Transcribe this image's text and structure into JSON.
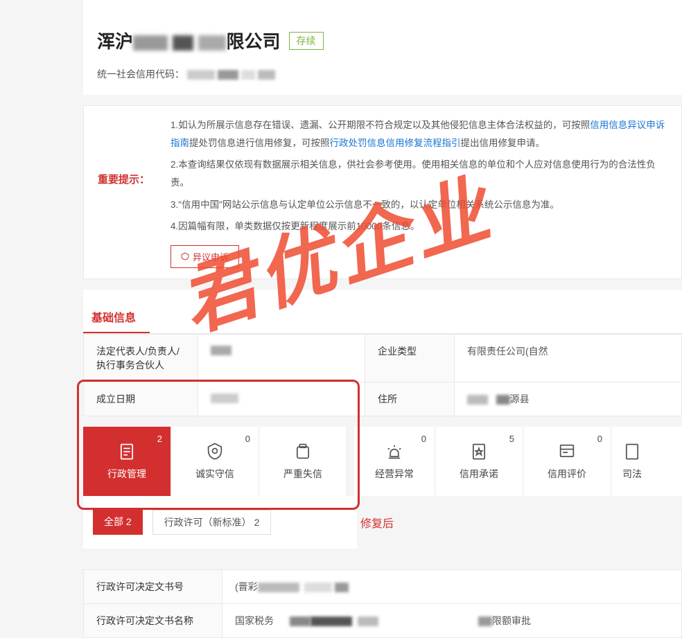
{
  "header": {
    "company_prefix": "浑沪",
    "company_suffix": "限公司",
    "status": "存续",
    "credit_code_label": "统一社会信用代码："
  },
  "notice": {
    "label": "重要提示：",
    "line1a": "1.如认为所展示信息存在错误、遗漏、公开期限不符合规定以及其他侵犯信息主体合法权益的，可按照",
    "link1": "信用信息异议申诉指南",
    "line1b": "提处罚信息进行信用修复，可按照",
    "link2": "行政处罚信息信用修复流程指引",
    "line1c": "提出信用修复申请。",
    "line2": "2.本查询结果仅依现有数据展示相关信息，供社会参考使用。使用相关信息的单位和个人应对信息使用行为的合法性负责。",
    "line3": "3.\"信用中国\"网站公示信息与认定单位公示信息不一致的，以认定单位相关系统公示信息为准。",
    "line4": "4.因篇幅有限，单类数据仅按更新程度展示前10000条信息。",
    "appeal_btn": "异议申诉"
  },
  "basic_info": {
    "title": "基础信息",
    "rows": [
      {
        "label1": "法定代表人/负责人/执行事务合伙人",
        "label2": "企业类型",
        "value2": "有限责任公司(自然"
      },
      {
        "label1": "成立日期",
        "label2": "住所",
        "value2": ""
      }
    ]
  },
  "tabs": [
    {
      "label": "行政管理",
      "count": "2",
      "active": true
    },
    {
      "label": "诚实守信",
      "count": "0",
      "active": false
    },
    {
      "label": "严重失信",
      "count": "",
      "active": false
    },
    {
      "label": "经营异常",
      "count": "0",
      "active": false
    },
    {
      "label": "信用承诺",
      "count": "5",
      "active": false
    },
    {
      "label": "信用评价",
      "count": "0",
      "active": false
    },
    {
      "label": "司法",
      "count": "",
      "active": false
    }
  ],
  "sub_tabs": {
    "all": "全部  2",
    "permit": "行政许可（新标准）  2"
  },
  "after_label": "修复后",
  "doc_table": {
    "row1_label": "行政许可决定文书号",
    "row1_value": "(晋彩",
    "row2_label": "行政许可决定文书名称",
    "row2_value_a": "国家税务",
    "row2_value_b": "限额审批"
  },
  "watermark": "君优企业"
}
